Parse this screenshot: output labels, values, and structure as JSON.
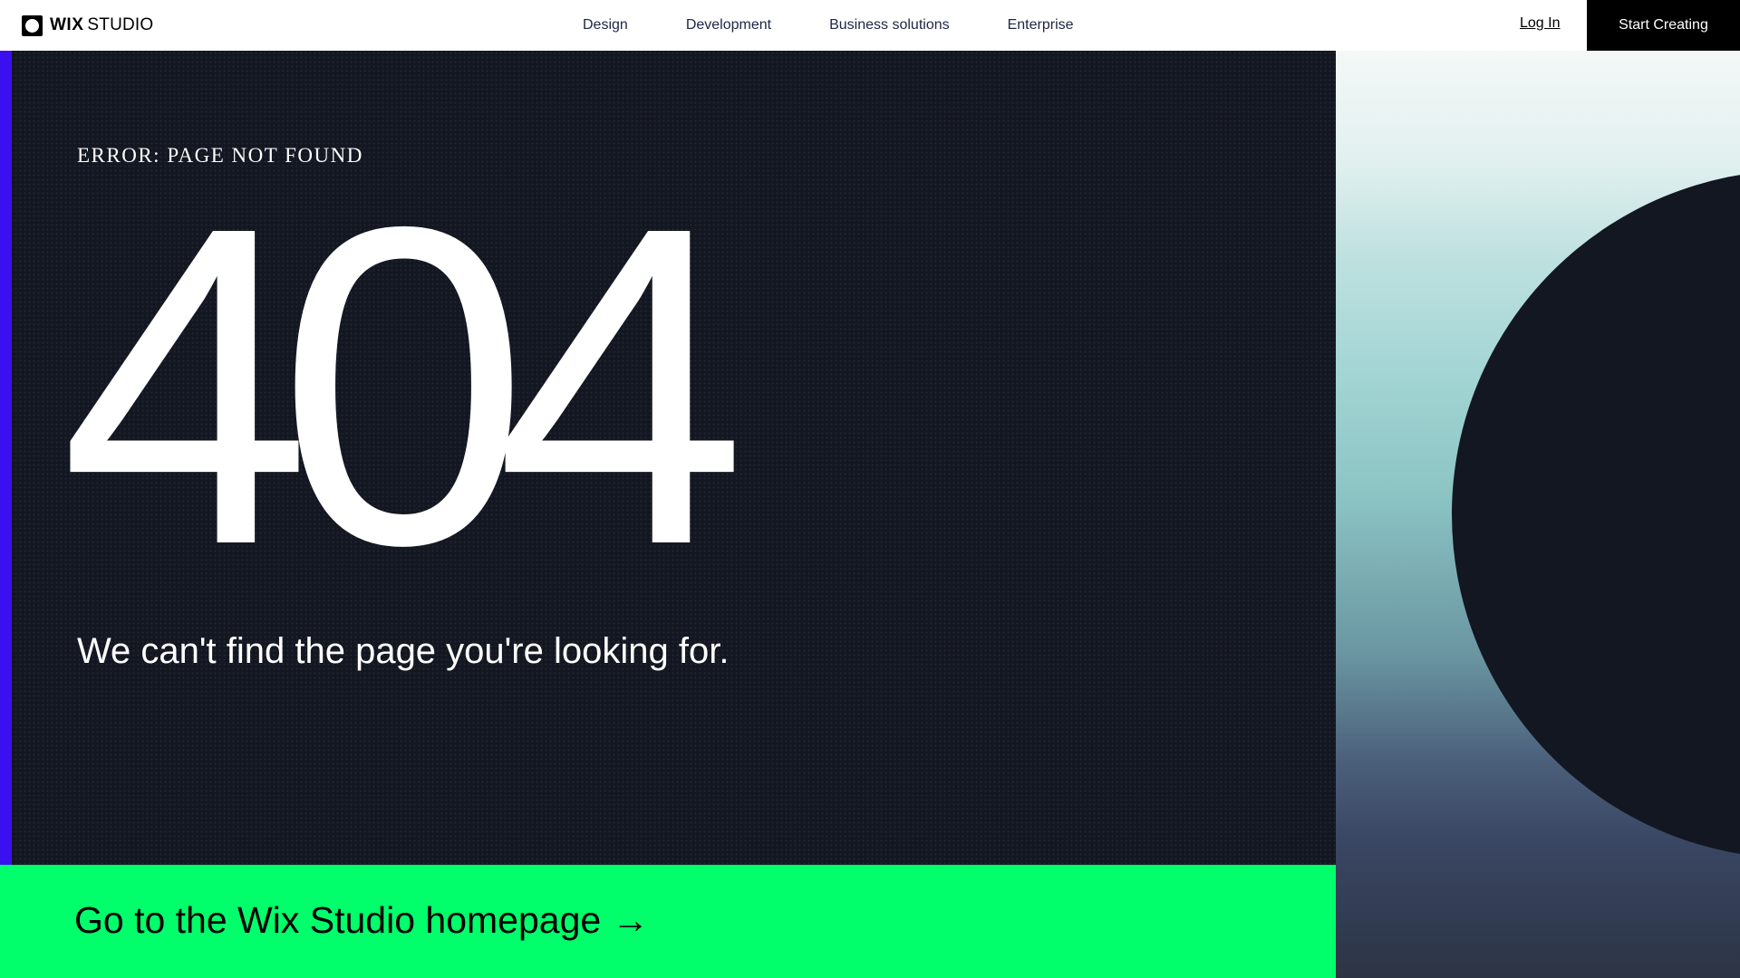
{
  "header": {
    "logo": {
      "wordmark_bold": "WIX",
      "wordmark_light": "STUDIO"
    },
    "nav": [
      {
        "label": "Design"
      },
      {
        "label": "Development"
      },
      {
        "label": "Business solutions"
      },
      {
        "label": "Enterprise"
      }
    ],
    "login_label": "Log In",
    "cta_label": "Start Creating"
  },
  "error": {
    "eyebrow": "ERROR: PAGE NOT FOUND",
    "code": "404",
    "message": "We can't find the page you're looking for."
  },
  "homepage_link": {
    "label": "Go to the Wix Studio homepage",
    "arrow": "→"
  },
  "colors": {
    "panel_bg": "#131721",
    "accent_bar": "#3b10f0",
    "cta_bg": "#00ff6a",
    "header_bg": "#ffffff",
    "start_button_bg": "#000000"
  },
  "icons": {
    "logo": "wix-logo-icon",
    "arrow": "arrow-right-icon"
  }
}
